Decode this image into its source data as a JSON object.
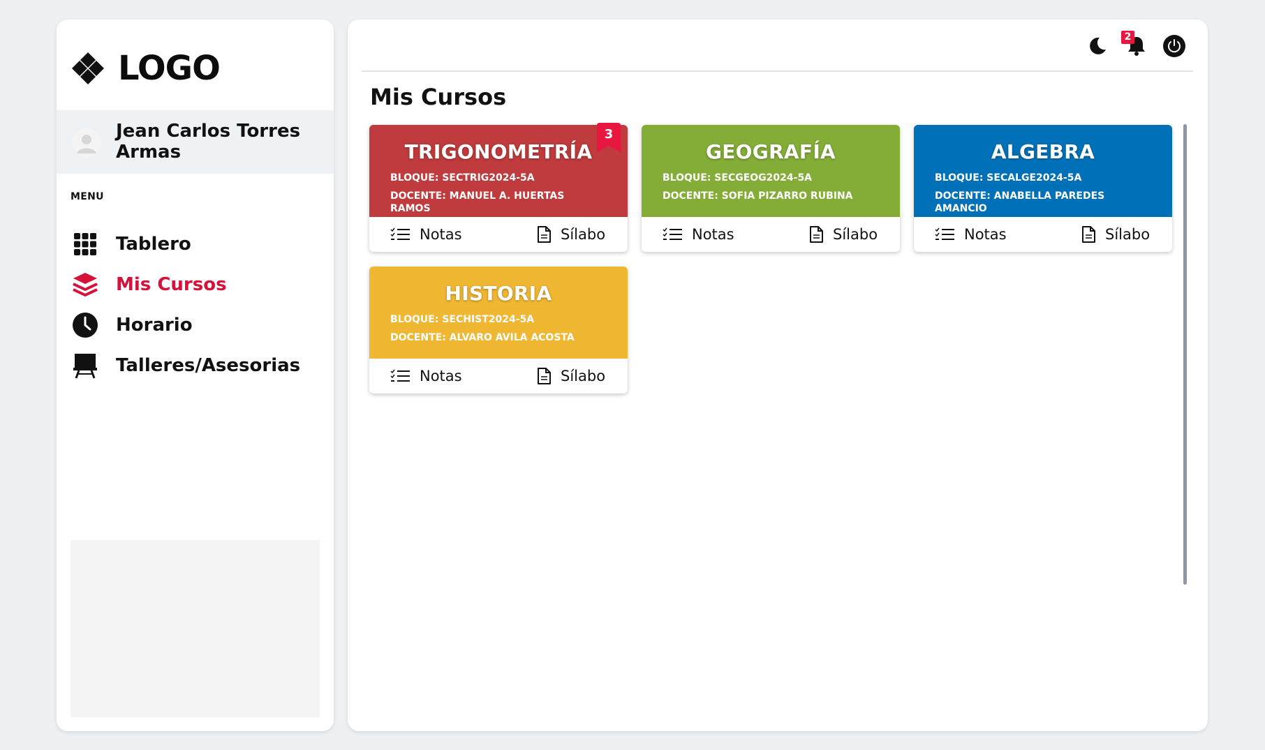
{
  "brand": {
    "logo_text": "LOGO"
  },
  "user": {
    "name": "Jean Carlos Torres Armas"
  },
  "menu": {
    "title": "MENU",
    "items": [
      {
        "label": "Tablero",
        "icon": "grid-icon",
        "active": false
      },
      {
        "label": "Mis Cursos",
        "icon": "layers-icon",
        "active": true
      },
      {
        "label": "Horario",
        "icon": "clock-icon",
        "active": false
      },
      {
        "label": "Talleres/Asesorias",
        "icon": "easel-icon",
        "active": false
      }
    ]
  },
  "topbar": {
    "notification_count": "2"
  },
  "page": {
    "title": "Mis Cursos"
  },
  "courses": [
    {
      "title": "TRIGONOMETRÍA",
      "block": "BLOQUE: SECTRIG2024-5A",
      "teacher": "DOCENTE: MANUEL A. HUERTAS RAMOS",
      "color": "#bf3b3d",
      "badge": "3",
      "notes_label": "Notas",
      "syllabus_label": "Sílabo"
    },
    {
      "title": "GEOGRAFÍA",
      "block": "BLOQUE: SECGEOG2024-5A",
      "teacher": "DOCENTE: SOFIA PIZARRO RUBINA",
      "color": "#84ad37",
      "badge": "",
      "notes_label": "Notas",
      "syllabus_label": "Sílabo"
    },
    {
      "title": "ALGEBRA",
      "block": "BLOQUE: SECALGE2024-5A",
      "teacher": "DOCENTE: ANABELLA PAREDES AMANCIO",
      "color": "#0071b8",
      "badge": "",
      "notes_label": "Notas",
      "syllabus_label": "Sílabo"
    },
    {
      "title": "HISTORIA",
      "block": "BLOQUE: SECHIST2024-5A",
      "teacher": "DOCENTE: ALVARO AVILA ACOSTA",
      "color": "#f0b733",
      "badge": "",
      "notes_label": "Notas",
      "syllabus_label": "Sílabo"
    }
  ],
  "colors": {
    "accent": "#d6113a",
    "badge": "#e8173f",
    "background": "#edf1f3"
  }
}
